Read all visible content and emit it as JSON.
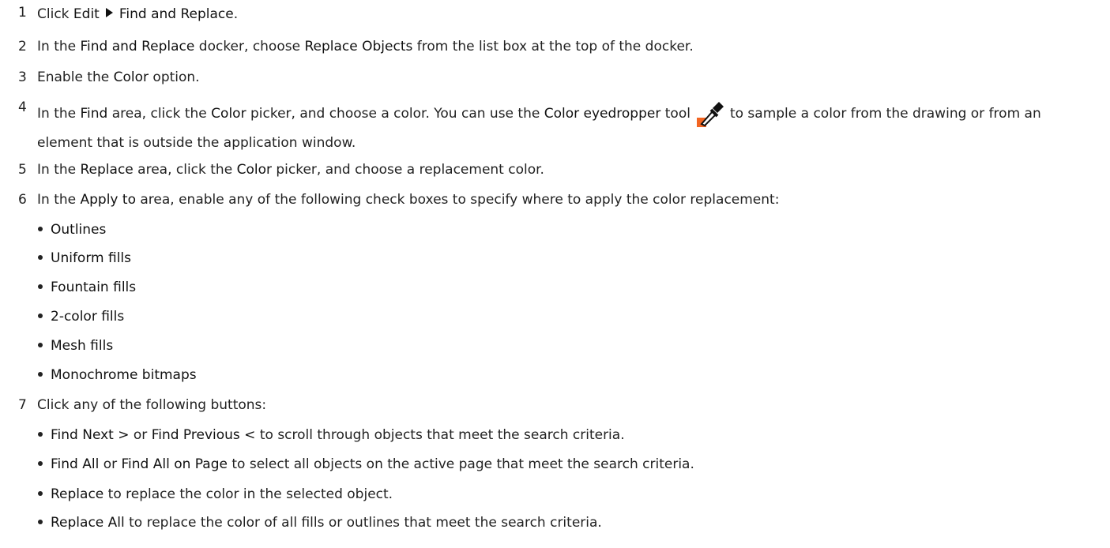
{
  "steps": [
    {
      "n": "1",
      "parts": [
        "Click",
        "Edit",
        "Find and Replace",
        "."
      ]
    },
    {
      "n": "2",
      "parts": [
        "In the",
        "Find and Replace",
        "docker, choose",
        "Replace Objects",
        "from the list box at the top of the docker."
      ]
    },
    {
      "n": "3",
      "parts": [
        "Enable the",
        "Color",
        "option."
      ]
    },
    {
      "n": "4",
      "parts": [
        "In the",
        "Find",
        "area, click the",
        "Color",
        "picker, and choose a color. You can use the",
        "Color eyedropper",
        "tool",
        "to sample a color from the drawing or from an element that is outside the application window."
      ]
    },
    {
      "n": "5",
      "parts": [
        "In the",
        "Replace",
        "area, click the",
        "Color",
        "picker, and choose a replacement color."
      ]
    },
    {
      "n": "6",
      "parts": [
        "In the",
        "Apply to",
        "area, enable any of the following check boxes to specify where to apply the color replacement:"
      ]
    },
    {
      "n": "7",
      "parts": [
        "Click any of the following buttons:"
      ]
    }
  ],
  "apply_to": [
    "Outlines",
    "Uniform fills",
    "Fountain fills",
    "2-color fills",
    "Mesh fills",
    "Monochrome bitmaps"
  ],
  "buttons": [
    {
      "parts": [
        "Find Next >",
        "or",
        "Find Previous <",
        "to scroll through objects that meet the search criteria."
      ]
    },
    {
      "parts": [
        "Find All",
        "or",
        "Find All on Page",
        "to select all objects on the active page that meet the search criteria."
      ]
    },
    {
      "parts": [
        "Replace",
        "to replace the color in the selected object."
      ]
    },
    {
      "parts": [
        "Replace All",
        "to replace the color of all fills or outlines that meet the search criteria."
      ]
    }
  ],
  "icons": {
    "menu_arrow": "triangle-right-icon",
    "eyedropper": "eyedropper-icon",
    "eyedropper_color": "#F26522"
  }
}
